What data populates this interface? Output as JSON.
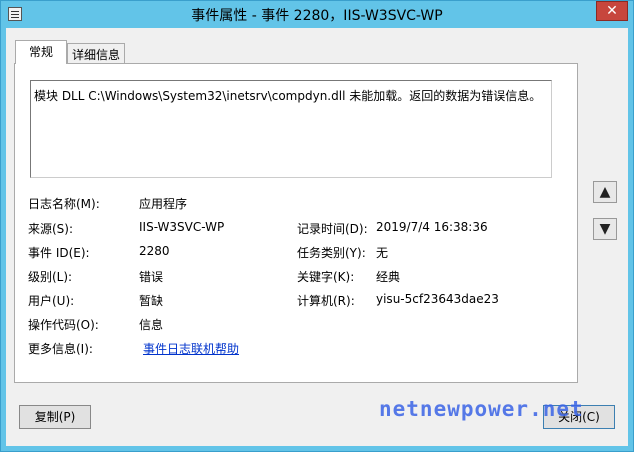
{
  "window": {
    "title": "事件属性 - 事件 2280，IIS-W3SVC-WP",
    "close_glyph": "✕"
  },
  "tabs": [
    {
      "label": "常规"
    },
    {
      "label": "详细信息"
    }
  ],
  "message": "模块 DLL C:\\Windows\\System32\\inetsrv\\compdyn.dll 未能加载。返回的数据为错误信息。",
  "fields": {
    "log_name": {
      "label": "日志名称(M):",
      "value": "应用程序"
    },
    "source": {
      "label": "来源(S):",
      "value": "IIS-W3SVC-WP"
    },
    "logged": {
      "label": "记录时间(D):",
      "value": "2019/7/4 16:38:36"
    },
    "event_id": {
      "label": "事件 ID(E):",
      "value": "2280"
    },
    "task_category": {
      "label": "任务类别(Y):",
      "value": "无"
    },
    "level": {
      "label": "级别(L):",
      "value": "错误"
    },
    "keywords": {
      "label": "关键字(K):",
      "value": "经典"
    },
    "user": {
      "label": "用户(U):",
      "value": "暂缺"
    },
    "computer": {
      "label": "计算机(R):",
      "value": "yisu-5cf23643dae23"
    },
    "opcode": {
      "label": "操作代码(O):",
      "value": "信息"
    },
    "more_info": {
      "label": "更多信息(I):",
      "value": "事件日志联机帮助"
    }
  },
  "buttons": {
    "copy": "复制(P)",
    "close": "关闭(C)",
    "up_glyph": "▲",
    "down_glyph": "▼"
  },
  "watermark": "netnewpower.net",
  "icons": {
    "app": "event-viewer-icon",
    "up": "arrow-up-icon",
    "down": "arrow-down-icon",
    "close": "close-icon"
  }
}
